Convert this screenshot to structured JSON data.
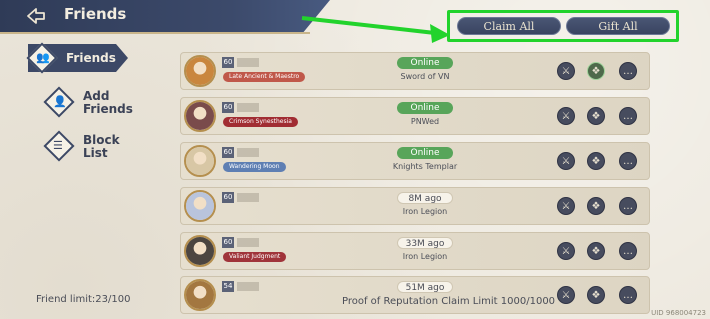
{
  "header": {
    "title": "Friends"
  },
  "top_buttons": {
    "claim_all": "Claim All",
    "gift_all": "Gift All"
  },
  "sidebar": {
    "items": [
      {
        "label": "Friends",
        "icon": "friends-icon",
        "active": true
      },
      {
        "label": "Add Friends",
        "icon": "add-friend-icon",
        "active": false
      },
      {
        "label": "Block List",
        "icon": "block-list-icon",
        "active": false
      }
    ]
  },
  "friends": [
    {
      "level": "60",
      "title": "Late Ancient & Maestro",
      "title_color": "#c0584a",
      "status": "Online",
      "guild": "Sword of VN",
      "avatar_color": "#c9863e"
    },
    {
      "level": "60",
      "title": "Crimson Synesthesia",
      "title_color": "#a12d33",
      "status": "Online",
      "guild": "PNWed",
      "avatar_color": "#7a4b4b"
    },
    {
      "level": "60",
      "title": "Wandering Moon",
      "title_color": "#5e7fb3",
      "status": "Online",
      "guild": "Knights Templar",
      "avatar_color": "#d8c7a5"
    },
    {
      "level": "60",
      "title": "",
      "title_color": "",
      "status": "8M ago",
      "guild": "Iron Legion",
      "avatar_color": "#b9c4dc"
    },
    {
      "level": "60",
      "title": "Valiant Judgment",
      "title_color": "#a0343a",
      "status": "33M ago",
      "guild": "Iron Legion",
      "avatar_color": "#4c4540"
    },
    {
      "level": "54",
      "title": "",
      "title_color": "",
      "status": "51M ago",
      "guild": "",
      "avatar_color": "#a37740"
    }
  ],
  "footer": {
    "friend_limit": "Friend limit:23/100",
    "reputation": "Proof of Reputation Claim Limit 1000/1000",
    "uid": "UID 968004723"
  },
  "colors": {
    "accent": "#3c4866",
    "online": "#58a55a",
    "highlight": "#22d32c"
  }
}
